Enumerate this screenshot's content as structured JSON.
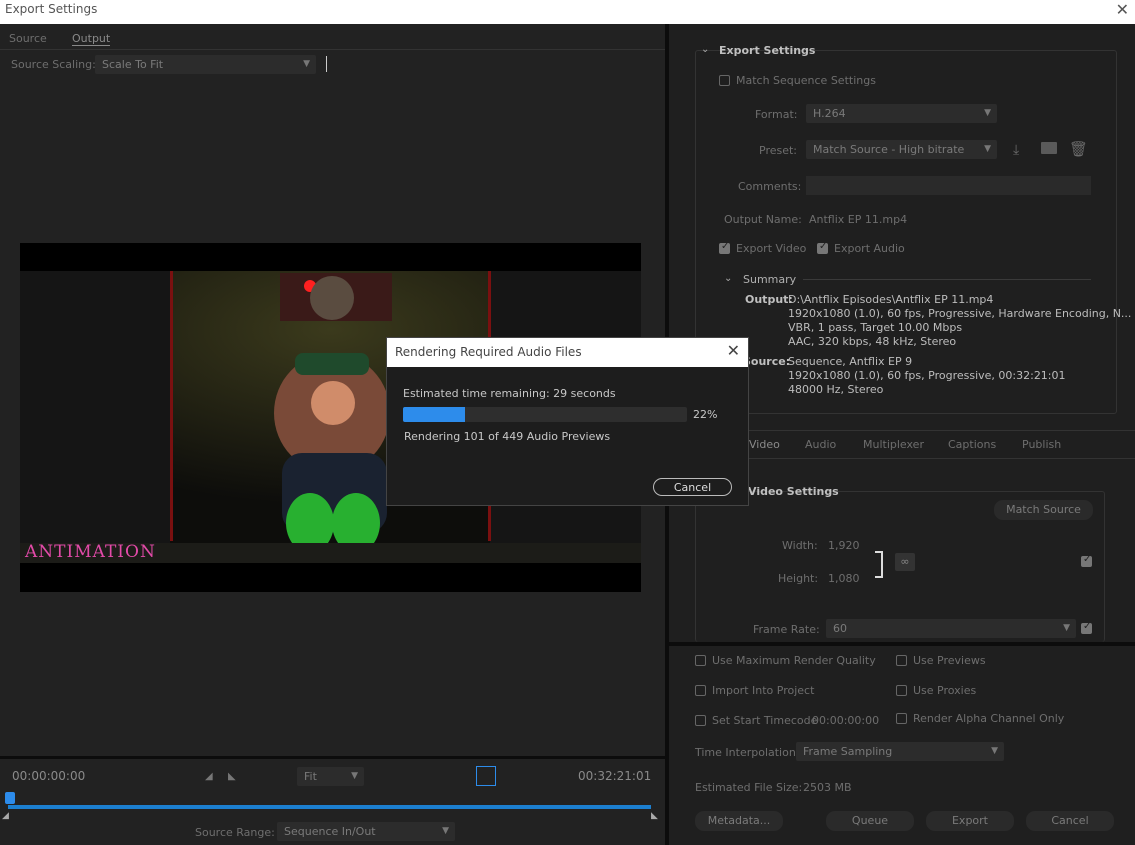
{
  "window": {
    "title": "Export Settings",
    "close_glyph": "✕"
  },
  "left": {
    "tabs": [
      "Source",
      "Output"
    ],
    "scaling_label": "Source Scaling:",
    "scaling_value": "Scale To Fit",
    "video_logo": "ANTIMATION",
    "timecode_start": "00:00:00:00",
    "timecode_end": "00:32:21:01",
    "fit_value": "Fit",
    "source_range_label": "Source Range:",
    "source_range_value": "Sequence In/Out"
  },
  "export_settings": {
    "section_title": "Export Settings",
    "match_sequence": "Match Sequence Settings",
    "format_label": "Format:",
    "format_value": "H.264",
    "preset_label": "Preset:",
    "preset_value": "Match Source - High bitrate",
    "comments_label": "Comments:",
    "output_name_label": "Output Name:",
    "output_name_value": "Antflix EP 11.mp4",
    "export_video": "Export Video",
    "export_audio": "Export Audio",
    "summary_title": "Summary",
    "output_label": "Output:",
    "output_lines": [
      "D:\\Antflix Episodes\\Antflix EP 11.mp4",
      "1920x1080 (1.0), 60 fps, Progressive, Hardware Encoding, N...",
      "VBR, 1 pass, Target 10.00 Mbps",
      "AAC, 320 kbps, 48 kHz, Stereo"
    ],
    "source_label": "Source:",
    "source_lines": [
      "Sequence, Antflix EP 9",
      "1920x1080 (1.0), 60 fps, Progressive, 00:32:21:01",
      "48000 Hz, Stereo"
    ]
  },
  "tabs": [
    "Video",
    "Audio",
    "Multiplexer",
    "Captions",
    "Publish"
  ],
  "video_settings": {
    "title": "Video Settings",
    "match_source": "Match Source",
    "width_label": "Width:",
    "width_value": "1,920",
    "height_label": "Height:",
    "height_value": "1,080",
    "frame_rate_label": "Frame Rate:",
    "frame_rate_value": "60"
  },
  "bottom": {
    "max_render": "Use Maximum Render Quality",
    "use_previews": "Use Previews",
    "import_project": "Import Into Project",
    "use_proxies": "Use Proxies",
    "set_start_tc": "Set Start Timecode",
    "start_tc_value": "00:00:00:00",
    "render_alpha": "Render Alpha Channel Only",
    "time_interp_label": "Time Interpolation:",
    "time_interp_value": "Frame Sampling",
    "file_size_label": "Estimated File Size:",
    "file_size_value": "2503 MB",
    "metadata": "Metadata...",
    "queue": "Queue",
    "export": "Export",
    "cancel": "Cancel"
  },
  "dialog": {
    "title": "Rendering Required Audio Files",
    "estimated": "Estimated time remaining: 29 seconds",
    "percent": "22%",
    "progress": 0.22,
    "status": "Rendering 101 of 449 Audio Previews",
    "cancel": "Cancel"
  },
  "colors": {
    "accent": "#2d8ceb",
    "timeline": "#1c7fd0"
  }
}
